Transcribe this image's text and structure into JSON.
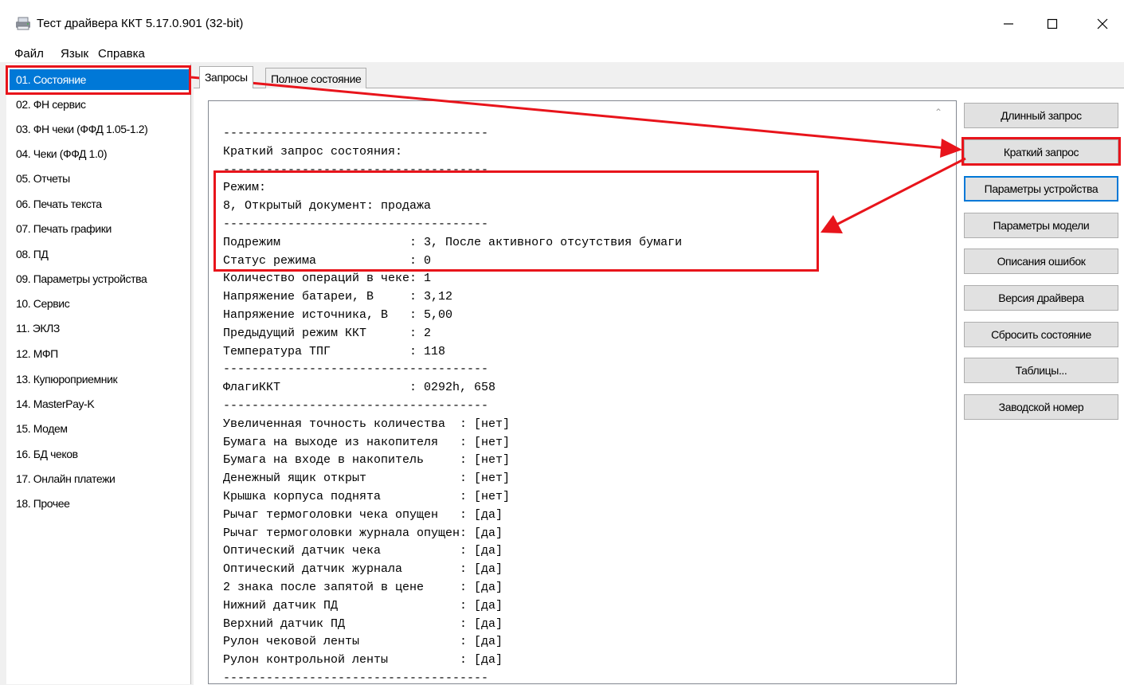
{
  "window": {
    "title": "Тест драйвера ККТ 5.17.0.901 (32-bit)",
    "minimize": "—",
    "maximize": "☐",
    "close": "✕"
  },
  "menu": [
    "Файл",
    "Язык",
    "Справка"
  ],
  "sidebar": {
    "selected_index": 0,
    "items": [
      "01. Состояние",
      "02. ФН сервис",
      "03. ФН чеки (ФФД 1.05-1.2)",
      "04. Чеки (ФФД 1.0)",
      "05. Отчеты",
      "06. Печать текста",
      "07. Печать графики",
      "08. ПД",
      "09. Параметры устройства",
      "10. Сервис",
      "11. ЭКЛЗ",
      "12. МФП",
      "13. Купюроприемник",
      "14. MasterPay-K",
      "15. Модем",
      "16. БД чеков",
      "17. Онлайн платежи",
      "18. Прочее"
    ]
  },
  "tabs": [
    {
      "label": "Запросы",
      "active": true
    },
    {
      "label": "Полное состояние",
      "active": false
    }
  ],
  "log_lines": [
    "-------------------------------------",
    "Краткий запрос состояния:",
    "-------------------------------------",
    "Режим:",
    "8, Открытый документ: продажа",
    "-------------------------------------",
    "Подрежим                  : 3, После активного отсутствия бумаги",
    "Статус режима             : 0",
    "Количество операций в чеке: 1",
    "Напряжение батареи, В     : 3,12",
    "Напряжение источника, В   : 5,00",
    "Предыдущий режим ККТ      : 2",
    "Температура ТПГ           : 118",
    "-------------------------------------",
    "ФлагиККТ                  : 0292h, 658",
    "-------------------------------------",
    "Увеличенная точность количества  : [нет]",
    "Бумага на выходе из накопителя   : [нет]",
    "Бумага на входе в накопитель     : [нет]",
    "Денежный ящик открыт             : [нет]",
    "Крышка корпуса поднята           : [нет]",
    "Рычаг термоголовки чека опущен   : [да]",
    "Рычаг термоголовки журнала опущен: [да]",
    "Оптический датчик чека           : [да]",
    "Оптический датчик журнала        : [да]",
    "2 знака после запятой в цене     : [да]",
    "Нижний датчик ПД                 : [да]",
    "Верхний датчик ПД                : [да]",
    "Рулон чековой ленты              : [да]",
    "Рулон контрольной ленты          : [да]",
    "-------------------------------------"
  ],
  "buttons": {
    "long_request": "Длинный запрос",
    "short_request": "Краткий запрос",
    "device_params": "Параметры устройства",
    "model_params": "Параметры модели",
    "error_descriptions": "Описания ошибок",
    "driver_version": "Версия драйвера",
    "reset_state": "Сбросить состояние",
    "tables": "Таблицы...",
    "serial_number": "Заводской номер"
  },
  "colors": {
    "selection": "#0078d7",
    "annotation": "#e8141b"
  }
}
